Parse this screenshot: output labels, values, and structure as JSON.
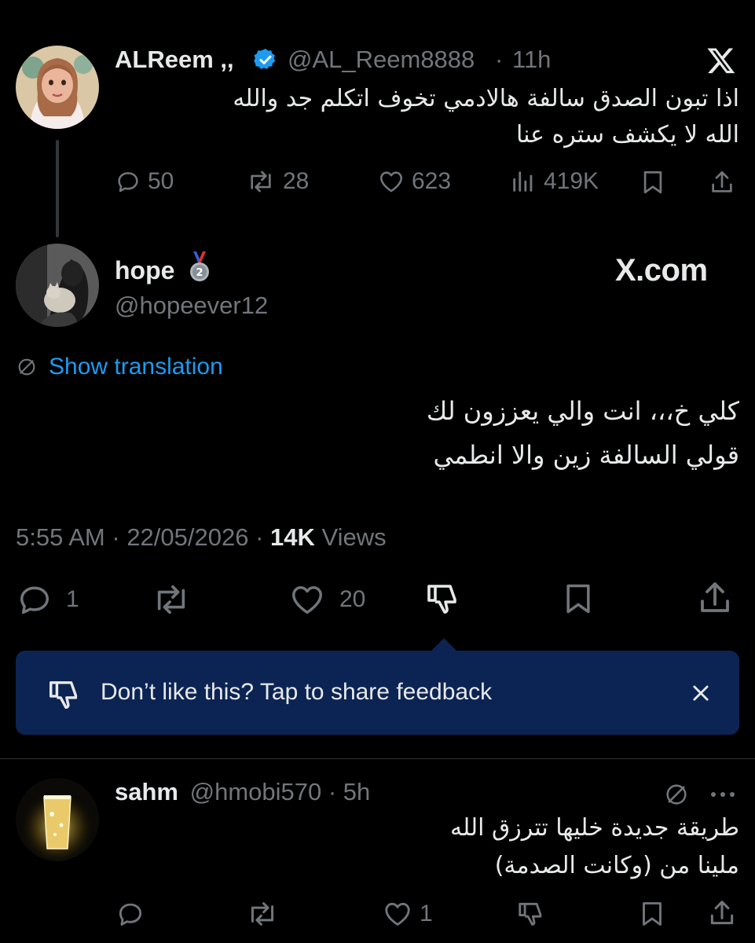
{
  "post1": {
    "display_name": "ALReem ,,",
    "handle": "@AL_Reem8888",
    "separator": "·",
    "time": "11h",
    "verified": true,
    "text_line1": "اذا تبون الصدق سالفة هالادمي تخوف اتكلم جد والله",
    "text_line2": "الله لا يكشف ستره عنا",
    "replies": "50",
    "reposts": "28",
    "likes": "623",
    "views": "419K"
  },
  "post2": {
    "display_name": "hope",
    "badge_icon": "medal-2-icon",
    "handle": "@hopeever12",
    "site_logo": "X.com",
    "show_translation": "Show translation",
    "text_line1": "كلي خ،،، انت والي يعززون لك",
    "text_line2": "قولي السالفة زين والا انطمي",
    "timestamp": "5:55 AM",
    "date": "22/05/2026",
    "views_count": "14K",
    "views_label": "Views",
    "replies": "1",
    "likes": "20"
  },
  "feedback_banner": {
    "text": "Don’t like this? Tap to share feedback"
  },
  "post3": {
    "display_name": "sahm",
    "handle": "@hmobi570",
    "time": "5h",
    "text_line1": "طريقة جديدة خليها تترزق الله",
    "text_line2": "ملينا من (وكانت الصدمة)",
    "likes": "1"
  },
  "colors": {
    "background": "#000000",
    "text": "#e7e9ea",
    "muted": "#71767b",
    "link": "#1d9bf0",
    "banner": "#0c2453"
  }
}
